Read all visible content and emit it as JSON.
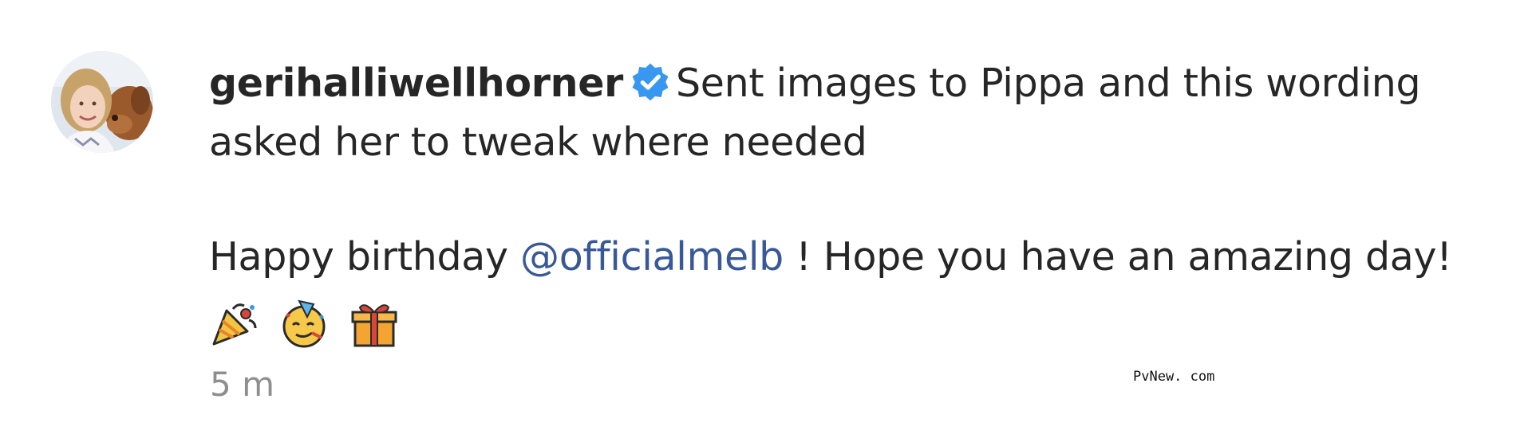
{
  "comment": {
    "username": "gerihalliwellhorner",
    "verified_icon": "verified-badge-icon",
    "text_line1": "Sent images to Pippa and this wording",
    "text_line2": "asked her to tweak where needed",
    "message_prefix": "Happy birthday ",
    "mention": "@officialmelb",
    "message_suffix": " ! Hope you have an amazing day!",
    "emojis": [
      "party-popper-icon",
      "partying-face-icon",
      "wrapped-gift-icon"
    ],
    "timestamp": "5 m"
  },
  "watermark": "PvNew. com",
  "colors": {
    "text": "#262626",
    "mention": "#385898",
    "verified": "#3897f0",
    "muted": "#8e8e8e"
  }
}
